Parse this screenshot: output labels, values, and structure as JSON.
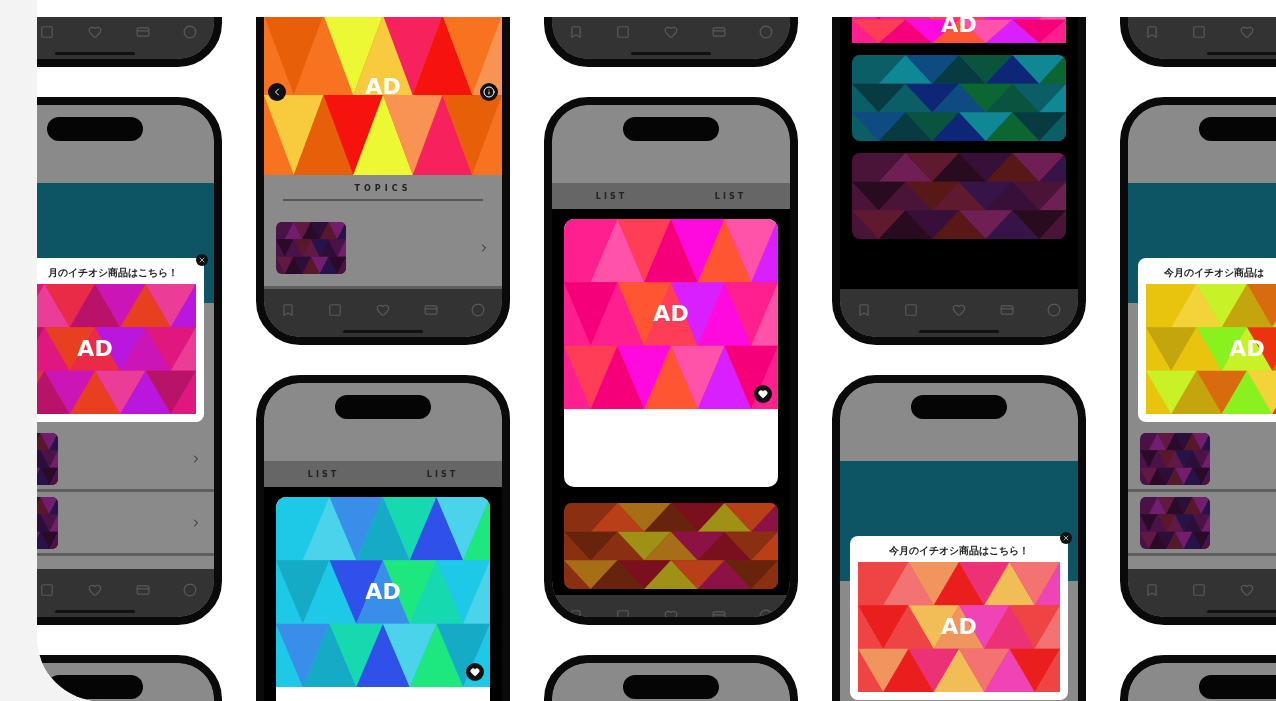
{
  "columns": [
    {
      "phones": [
        {
          "sections": [
            {
              "kind": "tabbar"
            }
          ]
        },
        {
          "sections": [
            {
              "kind": "header"
            },
            {
              "kind": "popup",
              "title": "月のイチオシ商品はこちら！",
              "color": "#e0177f",
              "ad": "AD"
            },
            {
              "kind": "list-item",
              "color": "#4a1348"
            },
            {
              "kind": "list-item",
              "color": "#4a1348"
            },
            {
              "kind": "tabbar"
            }
          ]
        },
        {
          "sections": [
            {
              "kind": "header"
            }
          ]
        }
      ]
    },
    {
      "phones": [
        {
          "sections": [
            {
              "kind": "hero-ad",
              "color": "#f7731f",
              "ad": "AD"
            },
            {
              "kind": "section-title",
              "title": "TOPICS"
            },
            {
              "kind": "list-item",
              "color": "#4a1348"
            },
            {
              "kind": "tabbar"
            }
          ]
        },
        {
          "sections": [
            {
              "kind": "header"
            },
            {
              "kind": "tabs",
              "tabs": [
                "LIST",
                "LIST"
              ]
            },
            {
              "kind": "card-ad",
              "color": "#1ec9e8",
              "ad": "AD"
            }
          ]
        }
      ]
    },
    {
      "phones": [
        {
          "sections": [
            {
              "kind": "tabbar"
            }
          ]
        },
        {
          "sections": [
            {
              "kind": "header"
            },
            {
              "kind": "tabs",
              "tabs": [
                "LIST",
                "LIST"
              ]
            },
            {
              "kind": "card-ad",
              "color": "#ff1f8f",
              "ad": "AD"
            },
            {
              "kind": "card-plain",
              "color": "#8a2f12"
            },
            {
              "kind": "tabbar"
            }
          ]
        },
        {
          "sections": [
            {
              "kind": "header"
            }
          ]
        }
      ]
    },
    {
      "phones": [
        {
          "sections": [
            {
              "kind": "ad-banner",
              "color": "#ff1f8f",
              "ad": "AD"
            },
            {
              "kind": "card-plain",
              "color": "#0b5d66"
            },
            {
              "kind": "card-plain",
              "color": "#4a1438"
            },
            {
              "kind": "spacer"
            },
            {
              "kind": "tabbar"
            }
          ]
        },
        {
          "sections": [
            {
              "kind": "header"
            },
            {
              "kind": "popup",
              "title": "今月のイチオシ商品はこちら！",
              "color": "#ef4444",
              "ad": "AD"
            }
          ]
        }
      ]
    },
    {
      "phones": [
        {
          "sections": [
            {
              "kind": "tabbar"
            }
          ]
        },
        {
          "sections": [
            {
              "kind": "header"
            },
            {
              "kind": "popup",
              "title": "今月のイチオシ商品は",
              "color": "#e9c40f",
              "ad": "AD"
            },
            {
              "kind": "list-item",
              "color": "#4a1348"
            },
            {
              "kind": "list-item",
              "color": "#4a1348"
            },
            {
              "kind": "tabbar"
            }
          ]
        },
        {
          "sections": [
            {
              "kind": "header"
            }
          ]
        }
      ]
    }
  ]
}
